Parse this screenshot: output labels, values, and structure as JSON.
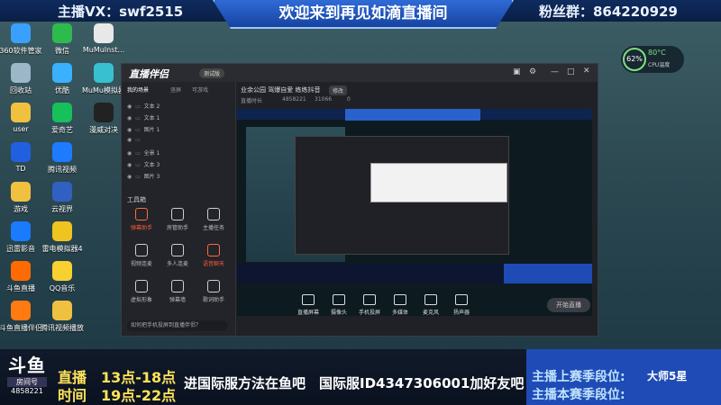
{
  "banner": {
    "left": "主播VX：swf2515",
    "center": "欢迎来到再见如滴直播间",
    "right": "粉丝群：864220929"
  },
  "desktop_icons": [
    {
      "label": "360软件管家",
      "color": "#3aa0ff"
    },
    {
      "label": "微信",
      "color": "#2dbb4e"
    },
    {
      "label": "MuMuInst...",
      "color": "#e8e8e8"
    },
    {
      "label": "回收站",
      "color": "#9bb7c8"
    },
    {
      "label": "优酷",
      "color": "#3ab0ff"
    },
    {
      "label": "MuMu模拟器",
      "color": "#38c0d0"
    },
    {
      "label": "user",
      "color": "#f0c040"
    },
    {
      "label": "爱奇艺",
      "color": "#16c05a"
    },
    {
      "label": "漫威对决",
      "color": "#222"
    },
    {
      "label": "TD",
      "color": "#2060e0"
    },
    {
      "label": "腾讯视频",
      "color": "#1e7bff"
    },
    {
      "label": "游戏",
      "color": "#f0c040"
    },
    {
      "label": "云视界",
      "color": "#3060c0"
    },
    {
      "label": "迅雷影音",
      "color": "#1a7bff"
    },
    {
      "label": "雷电模拟器4",
      "color": "#f0c420"
    },
    {
      "label": "斗鱼直播",
      "color": "#ff6b00"
    },
    {
      "label": "QQ音乐",
      "color": "#f8d030"
    },
    {
      "label": "斗鱼直播伴侣",
      "color": "#ff7a10"
    },
    {
      "label": "腾讯视频播放",
      "color": "#f0c040"
    }
  ],
  "cpu": {
    "percent": "62%",
    "temp": "80°C",
    "label": "CPU温度"
  },
  "app": {
    "title": "直播伴侣",
    "version": "测试版",
    "tabs": [
      "我的场景",
      "竖屏",
      "可游戏"
    ],
    "scenes": [
      "文本 2",
      "文本 1",
      "图片 1",
      "",
      "全景 1",
      "文本 3",
      "图片 3"
    ],
    "tools_header": "工具箱",
    "tools": [
      "弹幕助手",
      "房管助手",
      "主播任务",
      "视频连麦",
      "多人连麦",
      "语音聊天",
      "虚拟形象",
      "弹幕墙",
      "歌词助手"
    ],
    "hint": "如何把手机投屏到直播伴侣？",
    "stream_title": "业余公园 驾爆自爱 练练抖音",
    "stream_tag": "修改",
    "stream_info": [
      "直播时长",
      "4858221",
      "31066",
      "0"
    ],
    "bottom_buttons": [
      "直播屏幕",
      "摄像头",
      "手机投屏",
      "多媒体",
      "麦克风",
      "扬声器"
    ],
    "start_button": "开始直播"
  },
  "overlay": {
    "brand_big": "斗鱼",
    "brand_sub": "房间号",
    "room_id": "4858221",
    "live_label": "直播",
    "time_label": "时间",
    "live_time": "13点-18点",
    "time_slot": "19点-22点",
    "ticker": "进国际服方法在鱼吧　国际服ID4347306001加好友吧",
    "rank_last_label": "主播上赛季段位:",
    "rank_last_value": "大师5星",
    "rank_this_label": "主播本赛季段位:",
    "rank_this_value": ""
  },
  "colors": {
    "accent_blue": "#1e4bb5",
    "highlight_yellow": "#ffe35a",
    "live_red": "#ff5a3c"
  }
}
